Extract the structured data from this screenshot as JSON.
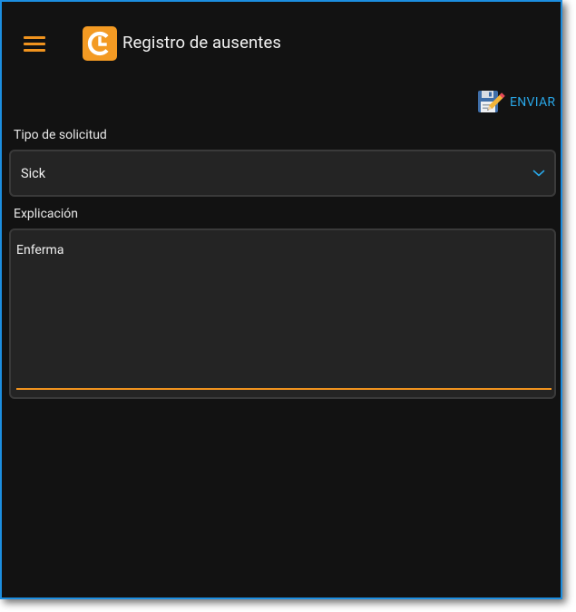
{
  "header": {
    "title": "Registro de ausentes",
    "menu_icon": "hamburger-menu-icon",
    "logo_icon": "app-logo-icon",
    "accent_color": "#f0931e"
  },
  "toolbar": {
    "send_label": "ENVIAR",
    "send_icon": "save-edit-icon",
    "send_color": "#29a6e6"
  },
  "form": {
    "tipo": {
      "label": "Tipo de solicitud",
      "value": "Sick",
      "dropdown_icon": "chevron-down-icon"
    },
    "explicacion": {
      "label": "Explicación",
      "value": "Enferma"
    }
  }
}
